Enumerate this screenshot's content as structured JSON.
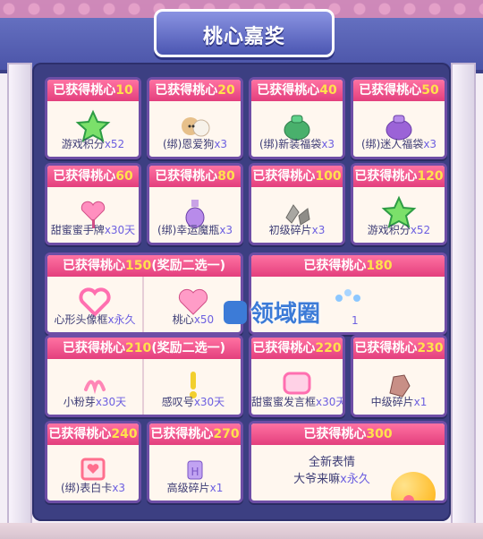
{
  "title": "桃心嘉奖",
  "brand": "领域圈",
  "rewards": [
    {
      "header": "已获得桃心",
      "threshold": "10",
      "name": "游戏积分",
      "qty": "x52",
      "icon": "star-icon"
    },
    {
      "header": "已获得桃心",
      "threshold": "20",
      "name": "(绑)恩爱狗",
      "qty": "x3",
      "icon": "dog-icon"
    },
    {
      "header": "已获得桃心",
      "threshold": "40",
      "name": "(绑)新装福袋",
      "qty": "x3",
      "icon": "bag-icon"
    },
    {
      "header": "已获得桃心",
      "threshold": "50",
      "name": "(绑)迷人福袋",
      "qty": "x3",
      "icon": "purple-bag-icon"
    },
    {
      "header": "已获得桃心",
      "threshold": "60",
      "name": "甜蜜蜜手牌",
      "qty": "x30天",
      "icon": "heart-sign-icon"
    },
    {
      "header": "已获得桃心",
      "threshold": "80",
      "name": "(绑)幸运魔瓶",
      "qty": "x3",
      "icon": "bottle-icon"
    },
    {
      "header": "已获得桃心",
      "threshold": "100",
      "name": "初级碎片",
      "qty": "x3",
      "icon": "fragment-icon"
    },
    {
      "header": "已获得桃心",
      "threshold": "120",
      "name": "游戏积分",
      "qty": "x52",
      "icon": "star-icon"
    },
    {
      "header": "已获得桃心",
      "threshold": "150",
      "header_suffix": "(奖励二选一)",
      "items": [
        {
          "name": "心形头像框",
          "qty": "x永久",
          "icon": "heart-frame-icon"
        },
        {
          "name": "桃心",
          "qty": "x50",
          "icon": "heart-icon"
        }
      ]
    },
    {
      "header": "已获得桃心",
      "threshold": "180",
      "items": [
        {
          "name": "",
          "qty": "1",
          "icon": "beads-icon"
        }
      ]
    },
    {
      "header": "已获得桃心",
      "threshold": "210",
      "header_suffix": "(奖励二选一)",
      "items": [
        {
          "name": "小粉芽",
          "qty": "x30天",
          "icon": "sprout-icon"
        },
        {
          "name": "感叹号",
          "qty": "x30天",
          "icon": "exclamation-icon"
        }
      ]
    },
    {
      "header": "已获得桃心",
      "threshold": "220",
      "name": "甜蜜蜜发言框",
      "qty": "x30天",
      "icon": "chat-frame-icon"
    },
    {
      "header": "已获得桃心",
      "threshold": "230",
      "name": "中级碎片",
      "qty": "x1",
      "icon": "fragment-mid-icon"
    },
    {
      "header": "已获得桃心",
      "threshold": "240",
      "name": "(绑)表白卡",
      "qty": "x3",
      "icon": "love-card-icon"
    },
    {
      "header": "已获得桃心",
      "threshold": "270",
      "name": "高级碎片",
      "qty": "x1",
      "icon": "fragment-high-icon"
    },
    {
      "header": "已获得桃心",
      "threshold": "300",
      "line1": "全新表情",
      "line2a": "大爷来嘛",
      "line2b": "x永久",
      "icon": "kiss-emoji-icon"
    }
  ],
  "colors": {
    "header_pink": "#e33f7d",
    "threshold_yellow": "#ffe14c",
    "panel": "#3c3f82",
    "card_border": "#6e4ea6"
  }
}
